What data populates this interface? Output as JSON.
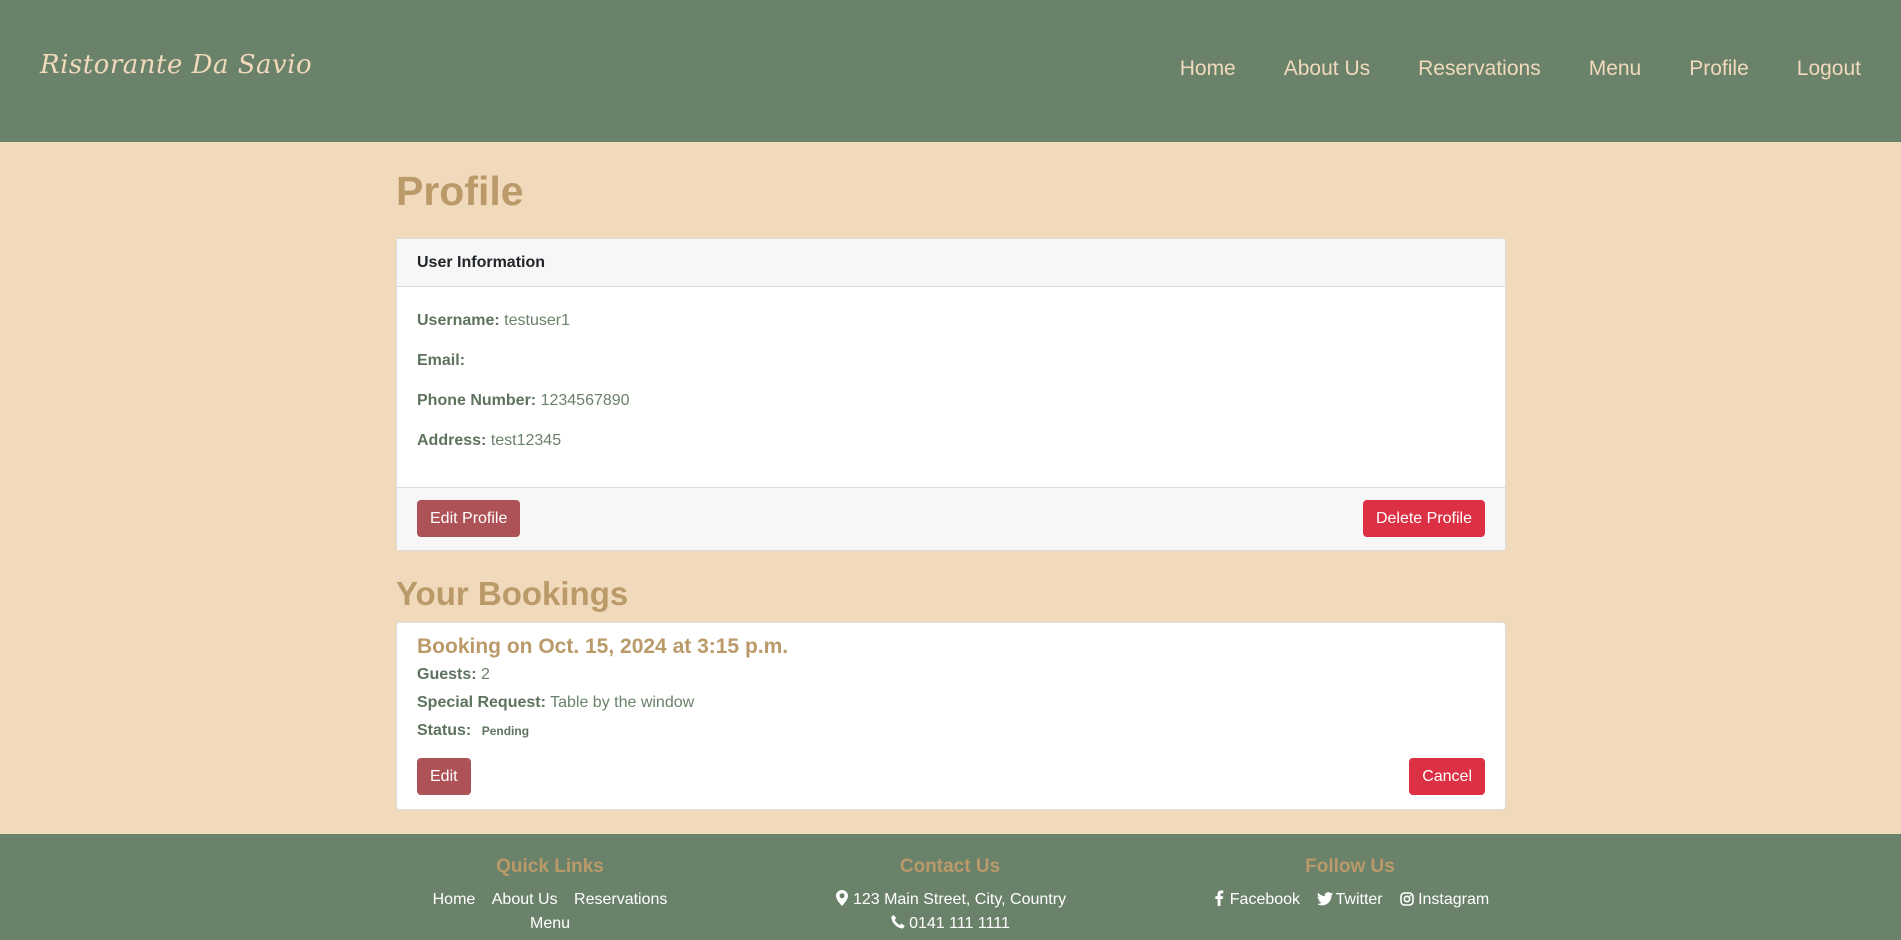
{
  "brand": "Ristorante Da Savio",
  "nav": {
    "home": "Home",
    "about": "About Us",
    "reservations": "Reservations",
    "menu": "Menu",
    "profile": "Profile",
    "logout": "Logout"
  },
  "page_title": "Profile",
  "user_card": {
    "header": "User Information",
    "username_label": "Username:",
    "username": "testuser1",
    "email_label": "Email:",
    "email": "",
    "phone_label": "Phone Number:",
    "phone": "1234567890",
    "address_label": "Address:",
    "address": "test12345",
    "edit_button": "Edit Profile",
    "delete_button": "Delete Profile"
  },
  "bookings_title": "Your Bookings",
  "booking": {
    "title": "Booking on Oct. 15, 2024 at 3:15 p.m.",
    "guests_label": "Guests:",
    "guests": "2",
    "request_label": "Special Request:",
    "request": "Table by the window",
    "status_label": "Status:",
    "status": "Pending",
    "edit_button": "Edit",
    "cancel_button": "Cancel"
  },
  "footer": {
    "quick_links_title": "Quick Links",
    "quick_links": [
      "Home",
      "About Us",
      "Reservations",
      "Menu"
    ],
    "contact_title": "Contact Us",
    "address": "123 Main Street, City, Country",
    "phone": "0141 111 1111",
    "follow_title": "Follow Us",
    "social": [
      "Facebook",
      "Twitter",
      "Instagram"
    ]
  },
  "colors": {
    "primary_green": "#6a816a",
    "background_beige": "#f1dabb",
    "heading_gold": "#bb9a6a",
    "edit_button": "#ad5257",
    "danger_button": "#dc3045"
  }
}
